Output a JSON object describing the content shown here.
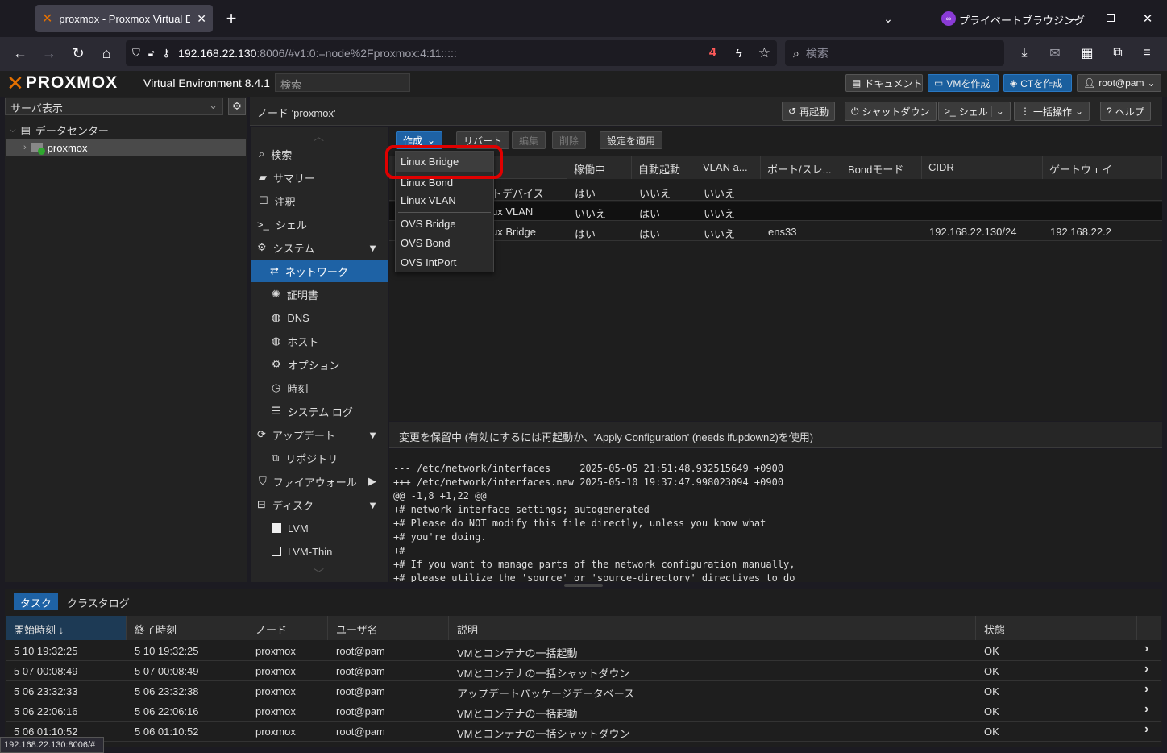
{
  "browser": {
    "tab_title": "proxmox - Proxmox Virtual Envi",
    "private_label": "プライベートブラウジング",
    "url_host": "192.168.22.130",
    "url_rest": ":8006/#v1:0:=node%2Fproxmox:4:11:::::",
    "badge": "4",
    "search_placeholder": "検索"
  },
  "pve": {
    "brand": "PROXMOX",
    "product": "Virtual Environment 8.4.1",
    "search_placeholder": "検索",
    "docs": "ドキュメント",
    "create_vm": "VMを作成",
    "create_ct": "CTを作成",
    "user": "root@pam",
    "view": "サーバ表示",
    "tree": {
      "datacenter": "データセンター",
      "node": "proxmox"
    },
    "node_title": "ノード 'proxmox'",
    "actions": {
      "reboot": "再起動",
      "shutdown": "シャットダウン",
      "shell": "シェル",
      "bulk": "一括操作",
      "help": "ヘルプ"
    }
  },
  "menu": [
    {
      "label": "検索",
      "icon": "search-icon"
    },
    {
      "label": "サマリー",
      "icon": "book-icon"
    },
    {
      "label": "注釈",
      "icon": "note-icon"
    },
    {
      "label": "シェル",
      "icon": "terminal-icon"
    },
    {
      "label": "システム",
      "icon": "cogs-icon"
    },
    {
      "label": "ネットワーク",
      "icon": "exchange-icon"
    },
    {
      "label": "証明書",
      "icon": "certificate-icon"
    },
    {
      "label": "DNS",
      "icon": "globe-icon"
    },
    {
      "label": "ホスト",
      "icon": "globe-icon"
    },
    {
      "label": "オプション",
      "icon": "gear-icon"
    },
    {
      "label": "時刻",
      "icon": "clock-icon"
    },
    {
      "label": "システム ログ",
      "icon": "list-icon"
    },
    {
      "label": "アップデート",
      "icon": "refresh-icon"
    },
    {
      "label": "リポジトリ",
      "icon": "files-icon"
    },
    {
      "label": "ファイアウォール",
      "icon": "shield-icon"
    },
    {
      "label": "ディスク",
      "icon": "hdd-icon"
    },
    {
      "label": "LVM",
      "icon": "square-icon"
    },
    {
      "label": "LVM-Thin",
      "icon": "square-outline-icon"
    }
  ],
  "toolbar": {
    "create": "作成",
    "revert": "リバート",
    "edit": "編集",
    "delete": "削除",
    "apply": "設定を適用"
  },
  "dropdown": [
    "Linux Bridge",
    "Linux Bond",
    "Linux VLAN",
    "OVS Bridge",
    "OVS Bond",
    "OVS IntPort"
  ],
  "net_table": {
    "headers": [
      "稼働中",
      "自動起動",
      "VLAN a...",
      "ポート/スレ...",
      "Bondモード",
      "CIDR",
      "ゲートウェイ"
    ],
    "rows": [
      [
        "トデバイス",
        "はい",
        "いいえ",
        "いいえ",
        "",
        "",
        "",
        ""
      ],
      [
        "ux VLAN",
        "いいえ",
        "はい",
        "いいえ",
        "",
        "",
        "",
        ""
      ],
      [
        "ux Bridge",
        "はい",
        "はい",
        "いいえ",
        "ens33",
        "",
        "192.168.22.130/24",
        "192.168.22.2"
      ]
    ]
  },
  "pending": {
    "header": "変更を保留中 (有効にするには再起動か、'Apply Configuration' (needs ifupdown2)を使用)",
    "lines": [
      "--- /etc/network/interfaces     2025-05-05 21:51:48.932515649 +0900",
      "+++ /etc/network/interfaces.new 2025-05-10 19:37:47.998023094 +0900",
      "@@ -1,8 +1,22 @@",
      "+# network interface settings; autogenerated",
      "+# Please do NOT modify this file directly, unless you know what",
      "+# you're doing.",
      "+#",
      "+# If you want to manage parts of the network configuration manually,",
      "+# please utilize the 'source' or 'source-directory' directives to do"
    ]
  },
  "tasks": {
    "tabs": [
      "タスク",
      "クラスタログ"
    ],
    "headers": [
      "開始時刻 ↓",
      "終了時刻",
      "ノード",
      "ユーザ名",
      "説明",
      "状態"
    ],
    "rows": [
      [
        "5 10 19:32:25",
        "5 10 19:32:25",
        "proxmox",
        "root@pam",
        "VMとコンテナの一括起動",
        "OK"
      ],
      [
        "5 07 00:08:49",
        "5 07 00:08:49",
        "proxmox",
        "root@pam",
        "VMとコンテナの一括シャットダウン",
        "OK"
      ],
      [
        "5 06 23:32:33",
        "5 06 23:32:38",
        "proxmox",
        "root@pam",
        "アップデートパッケージデータベース",
        "OK"
      ],
      [
        "5 06 22:06:16",
        "5 06 22:06:16",
        "proxmox",
        "root@pam",
        "VMとコンテナの一括起動",
        "OK"
      ],
      [
        "5 06 01:10:52",
        "5 06 01:10:52",
        "proxmox",
        "root@pam",
        "VMとコンテナの一括シャットダウン",
        "OK"
      ]
    ]
  },
  "statusbar": "192.168.22.130:8006/#"
}
